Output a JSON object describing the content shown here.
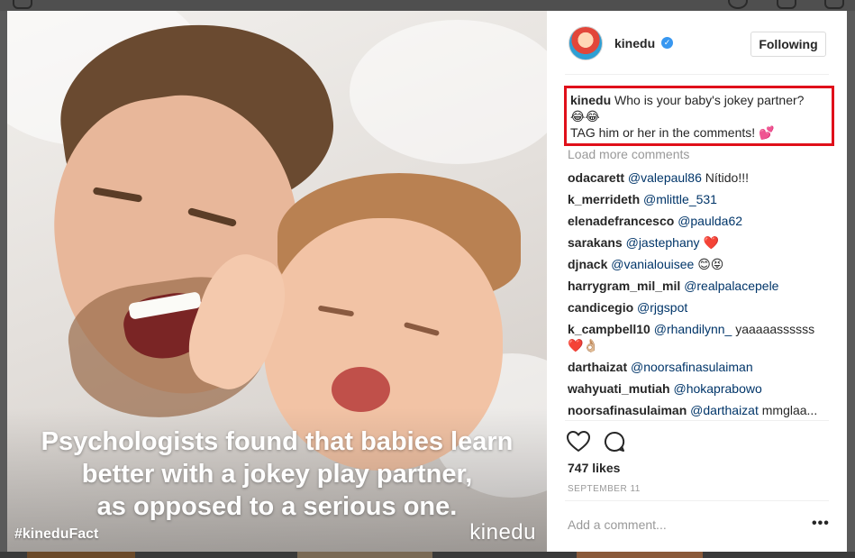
{
  "post": {
    "photo": {
      "caption_lines": [
        "Psychologists found that babies learn",
        "better with a jokey play partner,",
        "as opposed to a serious one."
      ],
      "hashtag": "#kineduFact",
      "brand": "kinedu"
    },
    "header": {
      "username": "kinedu",
      "verified_icon": "verified-badge-icon",
      "follow_label": "Following"
    },
    "caption": {
      "username": "kinedu",
      "text_line1": "Who is your baby's jokey partner?",
      "emoji_line1": "😂😂",
      "text_line2": "TAG him or her in the comments! 💕"
    },
    "load_more_label": "Load more comments",
    "comments": [
      {
        "user": "odacarett",
        "mention": "@valepaul86",
        "text": "Nítido!!!"
      },
      {
        "user": "k_merrideth",
        "mention": "@mlittle_531",
        "text": ""
      },
      {
        "user": "elenadefrancesco",
        "mention": "@paulda62",
        "text": ""
      },
      {
        "user": "sarakans",
        "mention": "@jastephany",
        "text": "❤️"
      },
      {
        "user": "djnack",
        "mention": "@vanialouisee",
        "text": "😊😝"
      },
      {
        "user": "harrygram_mil_mil",
        "mention": "@realpalacepele",
        "text": ""
      },
      {
        "user": "candicegio",
        "mention": "@rjgspot",
        "text": ""
      },
      {
        "user": "k_campbell10",
        "mention": "@rhandilynn_",
        "text": "yaaaaassssss ❤️👌🏼"
      },
      {
        "user": "darthaizat",
        "mention": "@noorsafinasulaiman",
        "text": ""
      },
      {
        "user": "wahyuati_mutiah",
        "mention": "@hokaprabowo",
        "text": ""
      },
      {
        "user": "noorsafinasulaiman",
        "mention": "@darthaizat",
        "text": "mmglaa..."
      }
    ],
    "actions": {
      "like_icon": "heart-icon",
      "comment_icon": "comment-bubble-icon"
    },
    "likes_label": "747 likes",
    "date_label": "SEPTEMBER 11",
    "add_comment_placeholder": "Add a comment...",
    "more_options_label": "•••"
  }
}
